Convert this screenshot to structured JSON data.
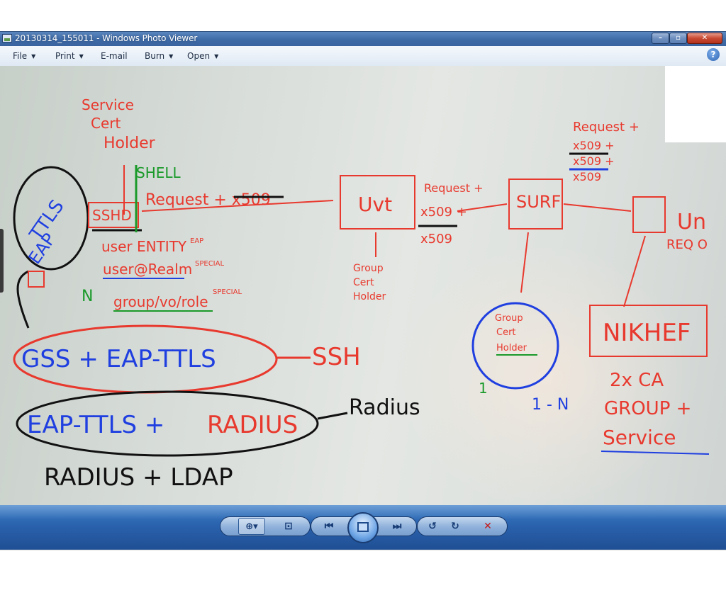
{
  "window": {
    "title": "20130314_155011 - Windows Photo Viewer"
  },
  "title_buttons": {
    "minimize_icon": "minimize-icon",
    "maximize_icon": "maximize-icon",
    "close_icon": "close-icon"
  },
  "menu": {
    "file": "File",
    "print": "Print",
    "email": "E-mail",
    "burn": "Burn",
    "open": "Open",
    "help_icon": "help-icon"
  },
  "whiteboard": {
    "service_cert_holder": [
      "Service",
      "Cert",
      "Holder"
    ],
    "shell": "SHELL",
    "request_x509": "Request + x509",
    "ttls_eap": [
      "TTLS",
      "EAP"
    ],
    "sshd": "SSHD",
    "user_entity": "user ENTITY",
    "eap_small": "EAP",
    "user_realm": "user@Realm",
    "special_1": "SPECIAL",
    "group_vo_role": "group/vo/role",
    "special_2": "SPECIAL",
    "n_mark": "N",
    "gss_eap_ttls": "GSS + EAP-TTLS",
    "ssh": "SSH",
    "eap_ttls": "EAP-TTLS +",
    "radius_red": "RADIUS",
    "radius_label": "Radius",
    "radius_ldap": "RADIUS + LDAP",
    "uvt": "Uvt",
    "request_x509_mid": "Request +",
    "x509_mid_1": "x509 +",
    "x509_mid_2": "x509",
    "group_cert_holder_left": [
      "Group",
      "Cert",
      "Holder"
    ],
    "surf": "SURF",
    "request_top": "Request +",
    "x509_top_1": "x509 +",
    "x509_top_2": "x509 +",
    "x509_top_3": "x509",
    "un": "Un",
    "req_o": "REQ O",
    "group_cert_holder_right": [
      "Group",
      "Cert",
      "Holder"
    ],
    "one_mark": "1",
    "one_n": "1 - N",
    "nikhef": "NIKHEF",
    "two_ca": "2x CA",
    "group_plus": "GROUP +",
    "service": "Service"
  },
  "controls": {
    "zoom_icon": "zoom-icon",
    "fit_icon": "actual-size-icon",
    "prev_icon": "previous-icon",
    "slideshow_icon": "slideshow-icon",
    "next_icon": "next-icon",
    "rotate_left_icon": "rotate-counterclockwise-icon",
    "rotate_right_icon": "rotate-clockwise-icon",
    "delete_icon": "delete-icon"
  },
  "colors": {
    "titlebar": "#3e6aa6",
    "marker_red": "#e8392e",
    "marker_blue": "#1f3fe0",
    "marker_black": "#111111",
    "marker_green": "#1a9a2a"
  }
}
